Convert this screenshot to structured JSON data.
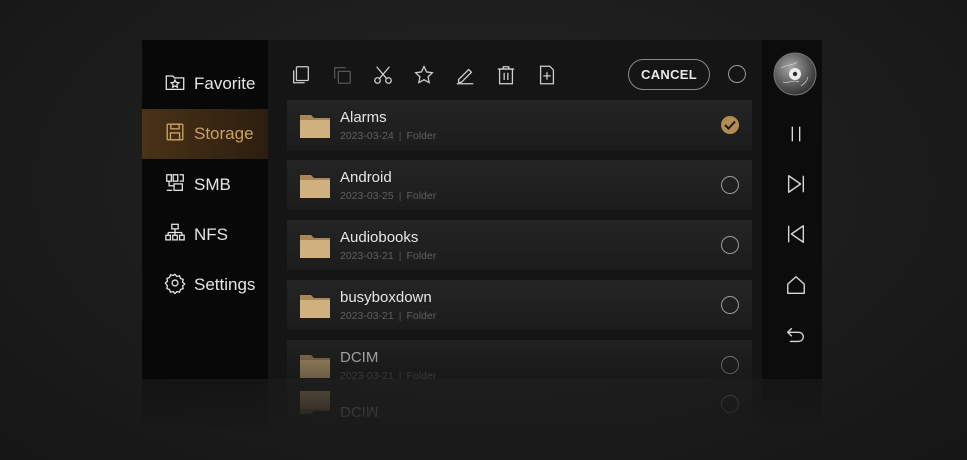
{
  "sidebar": {
    "items": [
      {
        "label": "Favorite",
        "icon": "star-folder-icon",
        "active": false
      },
      {
        "label": "Storage",
        "icon": "floppy-disk-icon",
        "active": true
      },
      {
        "label": "SMB",
        "icon": "smb-network-icon",
        "active": false
      },
      {
        "label": "NFS",
        "icon": "nfs-network-icon",
        "active": false
      },
      {
        "label": "Settings",
        "icon": "gear-icon",
        "active": false
      }
    ]
  },
  "toolbar": {
    "icons": [
      "copy-icon",
      "paste-icon",
      "cut-icon",
      "star-icon",
      "rename-icon",
      "delete-icon",
      "new-file-icon"
    ],
    "cancel_label": "CANCEL"
  },
  "files": [
    {
      "name": "Alarms",
      "date": "2023-03-24",
      "type": "Folder",
      "selected": true
    },
    {
      "name": "Android",
      "date": "2023-03-25",
      "type": "Folder",
      "selected": false
    },
    {
      "name": "Audiobooks",
      "date": "2023-03-21",
      "type": "Folder",
      "selected": false
    },
    {
      "name": "busyboxdown",
      "date": "2023-03-21",
      "type": "Folder",
      "selected": false
    },
    {
      "name": "DCIM",
      "date": "2023-03-21",
      "type": "Folder",
      "selected": false
    }
  ],
  "controls": [
    "disc-icon",
    "pause-icon",
    "next-track-icon",
    "previous-track-icon",
    "home-icon",
    "back-icon"
  ],
  "colors": {
    "accent": "#c9a061",
    "active_bg": "#4a3217",
    "check_on": "#b48c4f",
    "folder": "#c9a876",
    "background": "#1a1a1a"
  }
}
